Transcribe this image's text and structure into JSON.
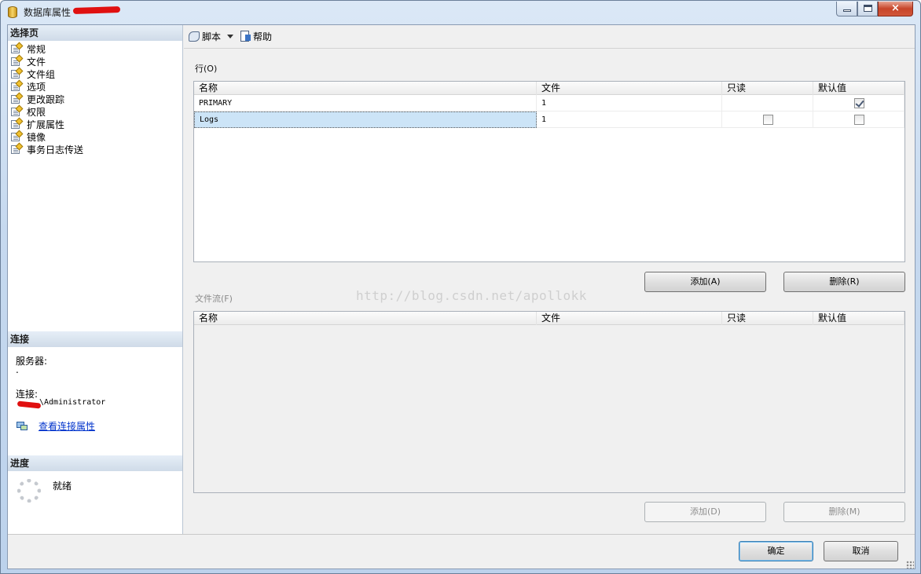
{
  "window": {
    "title": "数据库属性 - ",
    "controls": {
      "minimize": "minimize-icon",
      "maximize": "maximize-icon",
      "close": "×"
    }
  },
  "left": {
    "select_page_header": "选择页",
    "pages": [
      "常规",
      "文件",
      "文件组",
      "选项",
      "更改跟踪",
      "权限",
      "扩展属性",
      "镜像",
      "事务日志传送"
    ],
    "connection_header": "连接",
    "server_label": "服务器:",
    "server_value": ".",
    "connection_label": "连接:",
    "connection_value": "\\Administrator",
    "view_connection_link": "查看连接属性",
    "progress_header": "进度",
    "progress_status": "就绪"
  },
  "toolbar": {
    "script_label": "脚本",
    "help_label": "帮助"
  },
  "rows_group": {
    "label": "行(O)",
    "columns": [
      "名称",
      "文件",
      "只读",
      "默认值"
    ],
    "rows": [
      {
        "name": "PRIMARY",
        "files": "1",
        "readonly": null,
        "default": true
      },
      {
        "name": "Logs",
        "files": "1",
        "readonly": false,
        "default": false
      }
    ],
    "add_button": "添加(A)",
    "remove_button": "删除(R)"
  },
  "filestream_group": {
    "label": "文件流(F)",
    "columns": [
      "名称",
      "文件",
      "只读",
      "默认值"
    ],
    "add_button": "添加(D)",
    "remove_button": "删除(M)"
  },
  "watermark": "http://blog.csdn.net/apollokk",
  "footer": {
    "ok_button": "确定",
    "cancel_button": "取消"
  }
}
